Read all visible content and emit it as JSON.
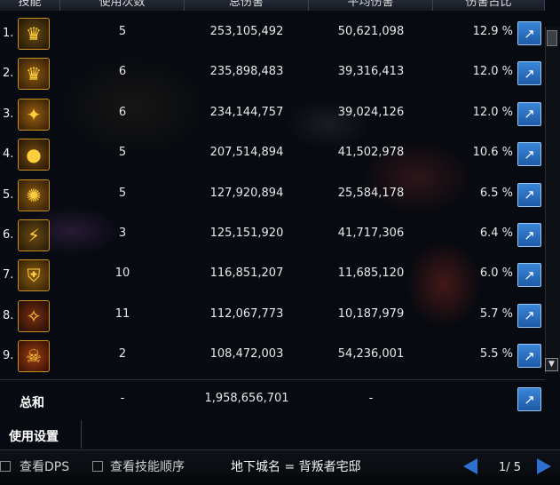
{
  "header": {
    "col_skill": "技能",
    "col_uses": "使用次数",
    "col_total": "总伤害",
    "col_avg": "平均伤害",
    "col_pct": "伤害占比"
  },
  "rows": [
    {
      "rank": "1.",
      "icon": "skill-icon-1",
      "uses": "5",
      "total": "253,105,492",
      "avg": "50,621,098",
      "pct": "12.9 %"
    },
    {
      "rank": "2.",
      "icon": "skill-icon-2",
      "uses": "6",
      "total": "235,898,483",
      "avg": "39,316,413",
      "pct": "12.0 %"
    },
    {
      "rank": "3.",
      "icon": "skill-icon-3",
      "uses": "6",
      "total": "234,144,757",
      "avg": "39,024,126",
      "pct": "12.0 %"
    },
    {
      "rank": "4.",
      "icon": "skill-icon-4",
      "uses": "5",
      "total": "207,514,894",
      "avg": "41,502,978",
      "pct": "10.6 %"
    },
    {
      "rank": "5.",
      "icon": "skill-icon-5",
      "uses": "5",
      "total": "127,920,894",
      "avg": "25,584,178",
      "pct": "6.5 %"
    },
    {
      "rank": "6.",
      "icon": "skill-icon-6",
      "uses": "3",
      "total": "125,151,920",
      "avg": "41,717,306",
      "pct": "6.4 %"
    },
    {
      "rank": "7.",
      "icon": "skill-icon-7",
      "uses": "10",
      "total": "116,851,207",
      "avg": "11,685,120",
      "pct": "6.0 %"
    },
    {
      "rank": "8.",
      "icon": "skill-icon-8",
      "uses": "11",
      "total": "112,067,773",
      "avg": "10,187,979",
      "pct": "5.7 %"
    },
    {
      "rank": "9.",
      "icon": "skill-icon-9",
      "uses": "2",
      "total": "108,472,003",
      "avg": "54,236,001",
      "pct": "5.5 %"
    }
  ],
  "summary": {
    "label": "总和",
    "uses": "-",
    "total": "1,958,656,701",
    "avg": "-"
  },
  "settings_label": "使用设置",
  "bottom": {
    "view_dps": "查看DPS",
    "view_order": "查看技能顺序",
    "dungeon": "地下城名 = 背叛者宅邸",
    "page": "1/ 5"
  },
  "colors": {
    "accent": "#2f6fd0",
    "share_button": "#3a86d8",
    "icon_gold": "#ffcf40"
  }
}
